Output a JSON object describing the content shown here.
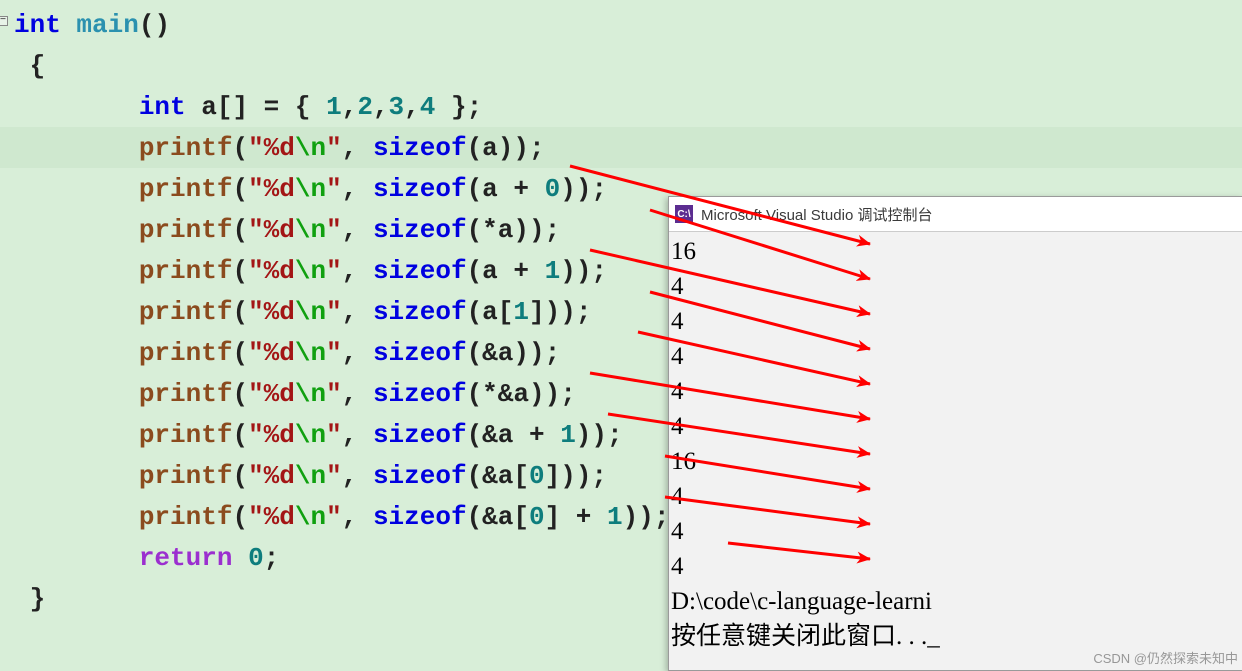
{
  "code": {
    "indent4": "    ",
    "indent8": "        ",
    "kw_int": "int",
    "main": "main",
    "paren_open": "(",
    "paren_close": ")",
    "brace_open": "{",
    "brace_close": "}",
    "a": "a",
    "brackets": "[]",
    "eq": " = ",
    "arr_open": "{ ",
    "n1": "1",
    "n2": "2",
    "n3": "3",
    "n4": "4",
    "comma": ",",
    "arr_close": " }",
    "semi": ";",
    "printf": "printf",
    "q": "\"",
    "fmt": "%d",
    "esc": "\\n",
    "comma_sp": ", ",
    "sizeof": "sizeof",
    "expr1": "a",
    "expr2_a": "a + ",
    "expr2_b": "0",
    "expr3": "*a",
    "expr4_a": "a + ",
    "expr4_b": "1",
    "expr5_a": "a[",
    "expr5_b": "1",
    "expr5_c": "]",
    "expr6": "&a",
    "expr7": "*&a",
    "expr8_a": "&a + ",
    "expr8_b": "1",
    "expr9_a": "&a[",
    "expr9_b": "0",
    "expr9_c": "]",
    "expr10_a": "&a[",
    "expr10_b": "0",
    "expr10_c": "] + ",
    "expr10_d": "1",
    "return": "return",
    "zero": "0"
  },
  "console": {
    "title": "Microsoft Visual Studio 调试控制台",
    "outputs": [
      "16",
      "4",
      "4",
      "4",
      "4",
      "4",
      "16",
      "4",
      "4",
      "4"
    ],
    "blank": "",
    "path": "D:\\code\\c-language-learni",
    "prompt": "按任意键关闭此窗口. . ._"
  },
  "watermark": "CSDN @仍然探索未知中"
}
